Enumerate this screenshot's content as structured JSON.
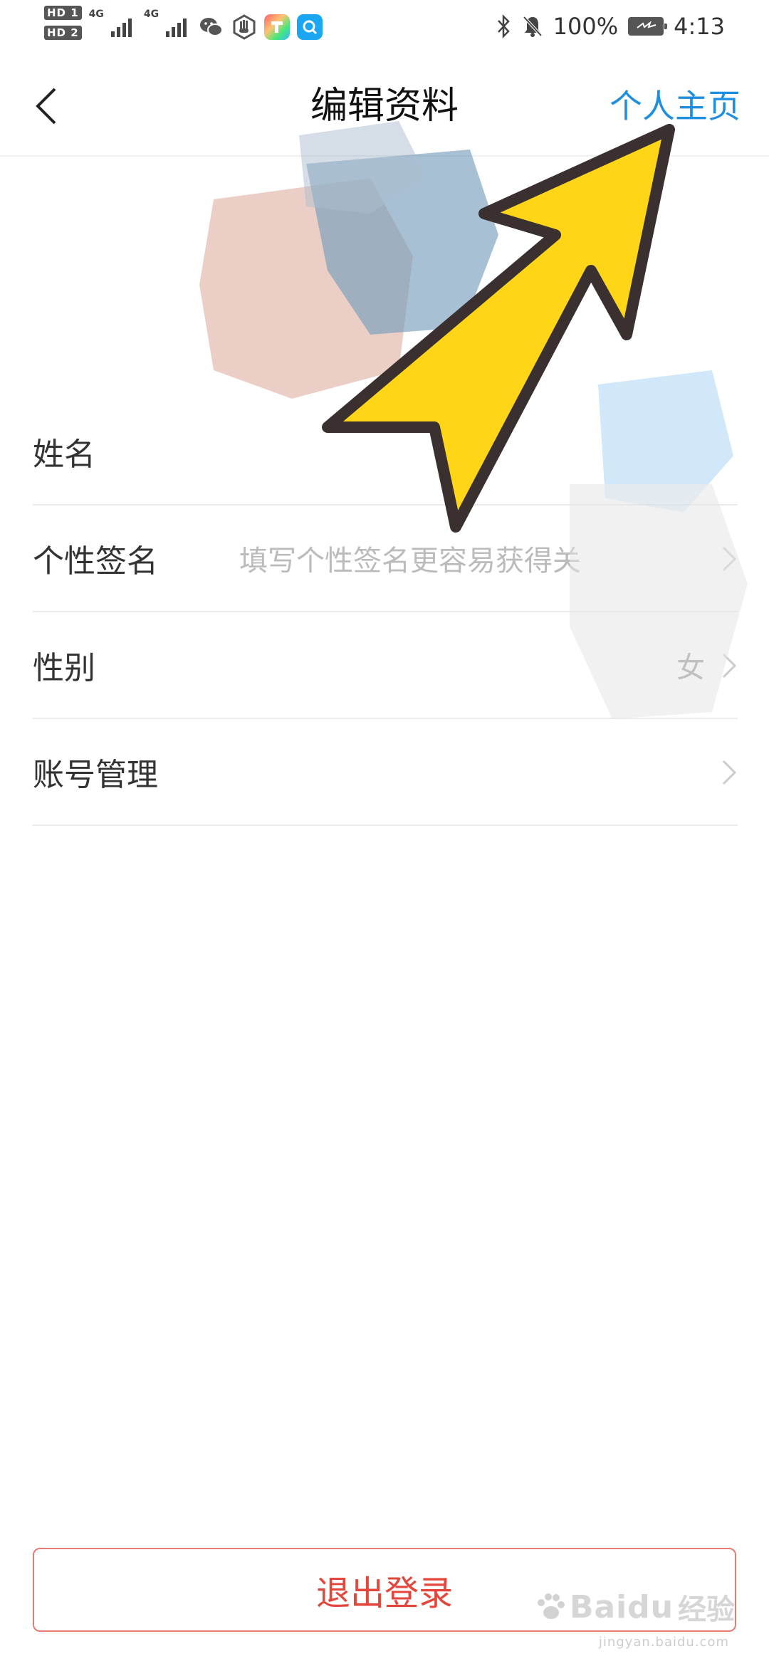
{
  "status_bar": {
    "sim1_label": "HD 1",
    "sim2_label": "HD 2",
    "network1": "4G",
    "network2": "4G",
    "battery": "100%",
    "time": "4:13"
  },
  "nav": {
    "title": "编辑资料",
    "action_label": "个人主页"
  },
  "form": {
    "rows": [
      {
        "label": "姓名",
        "value": ""
      },
      {
        "label": "个性签名",
        "placeholder": "填写个性签名更容易获得关"
      },
      {
        "label": "性别",
        "value": "女"
      },
      {
        "label": "账号管理",
        "value": ""
      }
    ]
  },
  "logout_label": "退出登录",
  "watermark": {
    "brand": "Baidu",
    "sub": "经验",
    "url": "jingyan.baidu.com"
  },
  "colors": {
    "accent": "#1e8fe0",
    "danger": "#e5463c",
    "arrow_fill": "#ffd617",
    "arrow_stroke": "#3a3030"
  }
}
